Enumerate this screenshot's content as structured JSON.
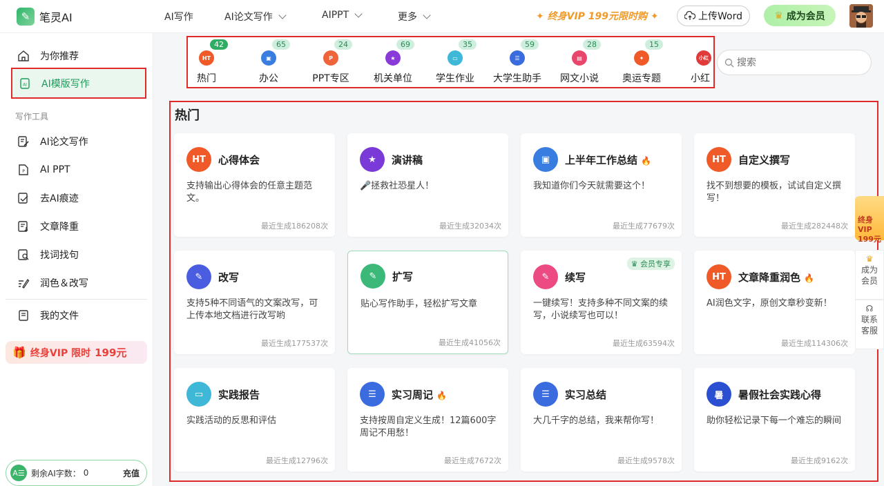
{
  "app": {
    "name": "笔灵AI"
  },
  "topnav": [
    {
      "label": "AI写作",
      "dropdown": false
    },
    {
      "label": "AI论文写作",
      "dropdown": true
    },
    {
      "label": "AIPPT",
      "dropdown": true
    },
    {
      "label": "更多",
      "dropdown": true
    }
  ],
  "header": {
    "vip_promo": "终身VIP 199元限时购",
    "upload_label": "上传Word",
    "member_label": "成为会员"
  },
  "sidebar": {
    "items_top": [
      {
        "label": "为你推荐",
        "icon": "home-icon"
      },
      {
        "label": "AI模版写作",
        "icon": "ai-template-icon",
        "active": true
      }
    ],
    "section_label": "写作工具",
    "tools": [
      {
        "label": "AI论文写作",
        "icon": "edit-doc-icon"
      },
      {
        "label": "AI PPT",
        "icon": "ppt-icon"
      },
      {
        "label": "去AI痕迹",
        "icon": "ai-trace-icon"
      },
      {
        "label": "文章降重",
        "icon": "reduce-icon"
      },
      {
        "label": "找词找句",
        "icon": "find-words-icon"
      },
      {
        "label": "润色＆改写",
        "icon": "polish-icon"
      }
    ],
    "my_files": "我的文件",
    "vip_banner": {
      "prefix": "终身VIP 限时",
      "price": "199元"
    },
    "quota": {
      "label": "剩余AI字数：",
      "value": "0",
      "recharge": "充值"
    }
  },
  "categories": [
    {
      "label": "热门",
      "count": "42",
      "icon_text": "HT",
      "color": "#f05a28",
      "active": true
    },
    {
      "label": "办公",
      "count": "65",
      "icon_text": "",
      "color": "#3a7de0"
    },
    {
      "label": "PPT专区",
      "count": "24",
      "icon_text": "P",
      "color": "#f0643c"
    },
    {
      "label": "机关单位",
      "count": "69",
      "icon_text": "★",
      "color": "#8a3ad8"
    },
    {
      "label": "学生作业",
      "count": "35",
      "icon_text": "",
      "color": "#3fb8d8"
    },
    {
      "label": "大学生助手",
      "count": "59",
      "icon_text": "",
      "color": "#3a6ce0"
    },
    {
      "label": "网文小说",
      "count": "28",
      "icon_text": "",
      "color": "#e8466a"
    },
    {
      "label": "奥运专题",
      "count": "15",
      "icon_text": "",
      "color": "#f05a28"
    },
    {
      "label": "小红",
      "count": "",
      "icon_text": "小红",
      "color": "#e03a3a"
    }
  ],
  "search": {
    "placeholder": "搜索"
  },
  "panel_title": "热门",
  "cards": [
    {
      "title": "心得体会",
      "desc": "支持输出心得体会的任意主题范文。",
      "count": "最近生成186208次",
      "icon_text": "HT",
      "color": "#f05a28",
      "flame": false
    },
    {
      "title": "演讲稿",
      "desc": "🎤拯救社恐星人！",
      "count": "最近生成32034次",
      "icon_text": "★",
      "color": "#7a3ad8",
      "flame": false
    },
    {
      "title": "上半年工作总结",
      "desc": "我知道你们今天就需要这个！",
      "count": "最近生成77679次",
      "icon_text": "▣",
      "color": "#3a7de0",
      "flame": true
    },
    {
      "title": "自定义撰写",
      "desc": "找不到想要的模板，试试自定义撰写！",
      "count": "最近生成282448次",
      "icon_text": "HT",
      "color": "#f05a28",
      "flame": false
    },
    {
      "title": "改写",
      "desc": "支持5种不同语气的文案改写，可上传本地文档进行改写哟",
      "count": "最近生成177537次",
      "icon_text": "✎",
      "color": "#4a5de0",
      "flame": false
    },
    {
      "title": "扩写",
      "desc": "贴心写作助手，轻松扩写文章",
      "count": "最近生成41056次",
      "icon_text": "✎",
      "color": "#3cb878",
      "flame": false,
      "highlight": true
    },
    {
      "title": "续写",
      "desc": "一键续写！支持多种不同文案的续写，小说续写也可以！",
      "count": "最近生成63594次",
      "icon_text": "✎",
      "color": "#ec4a82",
      "flame": false,
      "tag": "会员专享"
    },
    {
      "title": "文章降重润色",
      "desc": "AI润色文字，原创文章秒变新！",
      "count": "最近生成114306次",
      "icon_text": "HT",
      "color": "#f05a28",
      "flame": true
    },
    {
      "title": "实践报告",
      "desc": "实践活动的反思和评估",
      "count": "最近生成12796次",
      "icon_text": "▭",
      "color": "#3fb8d8",
      "flame": false
    },
    {
      "title": "实习周记",
      "desc": "支持按周自定义生成！12篇600字周记不用愁！",
      "count": "最近生成7672次",
      "icon_text": "☰",
      "color": "#3a6ce0",
      "flame": true
    },
    {
      "title": "实习总结",
      "desc": "大几千字的总结，我来帮你写！",
      "count": "最近生成9578次",
      "icon_text": "☰",
      "color": "#3a6ce0",
      "flame": false
    },
    {
      "title": "暑假社会实践心得",
      "desc": "助你轻松记录下每一个难忘的瞬间",
      "count": "最近生成9162次",
      "icon_text": "暑",
      "color": "#2a4fd0",
      "flame": false
    }
  ],
  "right_float": {
    "vip_text": "终身VIP 199元",
    "member_text": "成为会员",
    "service_text": "联系客服"
  }
}
